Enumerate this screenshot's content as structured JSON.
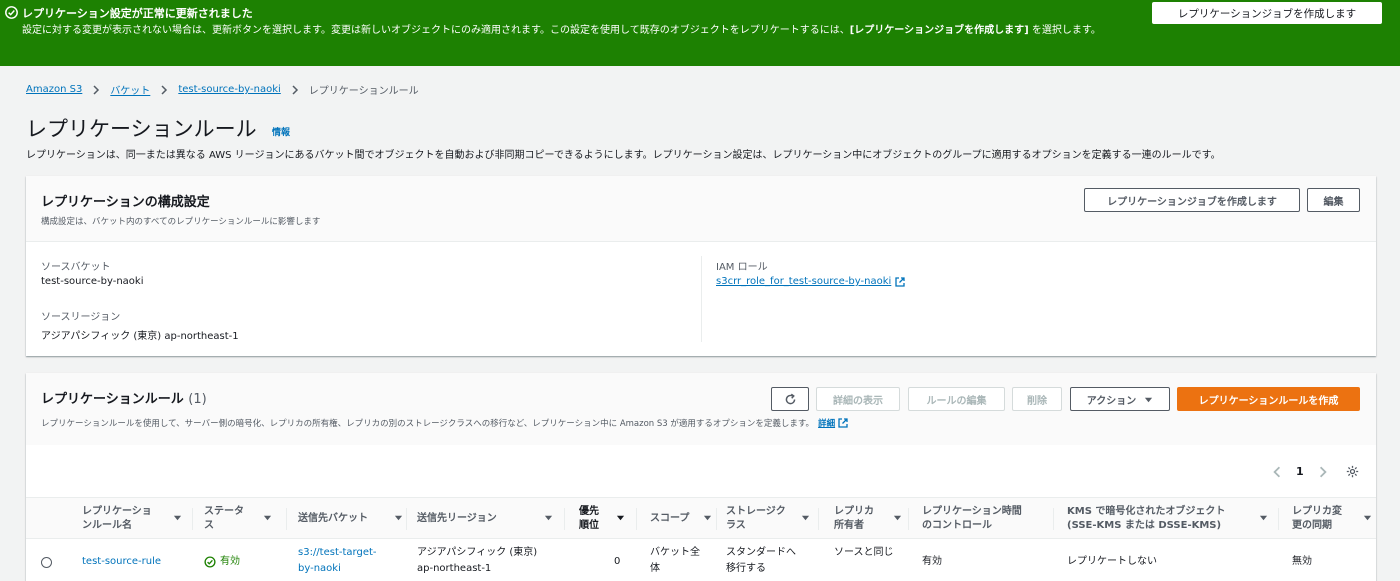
{
  "flash": {
    "title": "レプリケーション設定が正常に更新されました",
    "body_pre": "設定に対する変更が表示されない場合は、更新ボタンを選択します。変更は新しいオブジェクトにのみ適用されます。この設定を使用して既存のオブジェクトをレプリケートするには、",
    "body_bold": "[レプリケーションジョブを作成します]",
    "body_post": " を選択します。",
    "button": "レプリケーションジョブを作成します"
  },
  "breadcrumb": {
    "items": [
      "Amazon S3",
      "バケット",
      "test-source-by-naoki"
    ],
    "current": "レプリケーションルール"
  },
  "page": {
    "title": "レプリケーションルール",
    "info": "情報",
    "description": "レプリケーションは、同一または異なる AWS リージョンにあるバケット間でオブジェクトを自動および非同期コピーできるようにします。レプリケーション設定は、レプリケーション中にオブジェクトのグループに適用するオプションを定義する一連のルールです。"
  },
  "config": {
    "title": "レプリケーションの構成設定",
    "description": "構成設定は、バケット内のすべてのレプリケーションルールに影響します",
    "create_job_button": "レプリケーションジョブを作成します",
    "edit_button": "編集",
    "source_bucket_label": "ソースバケット",
    "source_bucket_value": "test-source-by-naoki",
    "source_region_label": "ソースリージョン",
    "source_region_value": "アジアパシフィック (東京) ap-northeast-1",
    "iam_role_label": "IAM ロール",
    "iam_role_value": "s3crr_role_for_test-source-by-naoki"
  },
  "rules": {
    "title": "レプリケーションルール",
    "count": "(1)",
    "description": "レプリケーションルールを使用して、サーバー側の暗号化、レプリカの所有権、レプリカの別のストレージクラスへの移行など、レプリケーション中に Amazon S3 が適用するオプションを定義します。",
    "learn_more": "詳細",
    "buttons": {
      "view_details": "詳細の表示",
      "edit_rule": "ルールの編集",
      "delete": "削除",
      "actions": "アクション",
      "create_rule": "レプリケーションルールを作成"
    },
    "page_number": "1",
    "columns": [
      "レプリケーションルール名",
      "ステータス",
      "送信先バケット",
      "送信先リージョン",
      "優先順位",
      "スコープ",
      "ストレージクラス",
      "レプリカ所有者",
      "レプリケーション時間のコントロール",
      "KMS で暗号化されたオブジェクト (SSE-KMS または DSSE-KMS)",
      "レプリカ変更の同期"
    ],
    "rows": [
      {
        "name": "test-source-rule",
        "status": "有効",
        "dest_bucket": "s3://test-target-by-naoki",
        "dest_region": "アジアパシフィック (東京) ap-northeast-1",
        "priority": "0",
        "scope": "バケット全体",
        "storage_class": "スタンダードへ移行する",
        "replica_owner": "ソースと同じ",
        "rtc": "有効",
        "kms": "レプリケートしない",
        "sync": "無効"
      }
    ]
  },
  "colors": {
    "flash_bg": "#1d8102",
    "link": "#0073bb",
    "primary": "#ec7211",
    "success": "#1d8102"
  }
}
